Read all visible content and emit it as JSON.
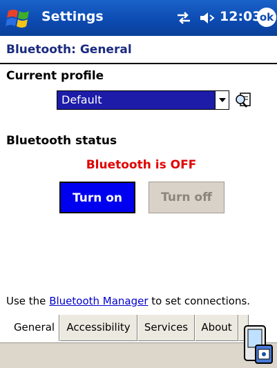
{
  "titlebar": {
    "title": "Settings",
    "time": "12:03",
    "ok_label": "ok",
    "icons": [
      "windows-start-icon",
      "connectivity-icon",
      "volume-icon"
    ]
  },
  "page": {
    "title": "Bluetooth: General"
  },
  "profile": {
    "label": "Current profile",
    "selected": "Default"
  },
  "status": {
    "label": "Bluetooth status",
    "text": "Bluetooth is OFF",
    "text_color": "#e00000"
  },
  "buttons": {
    "turn_on": "Turn on",
    "turn_off": "Turn off"
  },
  "footer": {
    "prefix": "Use the ",
    "link": "Bluetooth Manager",
    "suffix": " to set connections."
  },
  "tabs": [
    {
      "label": "General",
      "active": true
    },
    {
      "label": "Accessibility",
      "active": false
    },
    {
      "label": "Services",
      "active": false
    },
    {
      "label": "About",
      "active": false
    }
  ],
  "colors": {
    "titlebar": "#0c4ab0",
    "select_bg": "#1c1ca8",
    "turn_on_bg": "#0000f0",
    "turn_off_bg": "#d8d2c8"
  }
}
